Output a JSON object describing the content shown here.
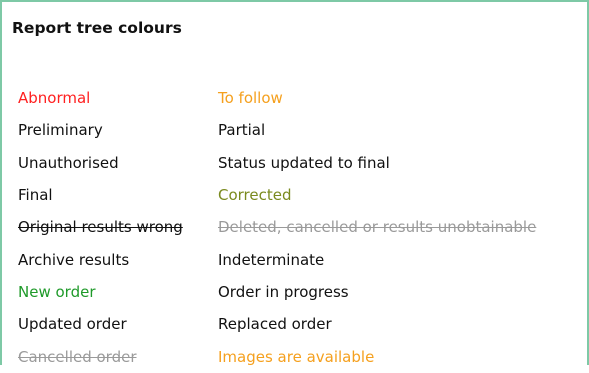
{
  "panel": {
    "title": "Report tree colours"
  },
  "legend": {
    "rows": [
      {
        "left": {
          "label": "Abnormal",
          "color": "#ff2020",
          "strikethrough": false
        },
        "right": {
          "label": "To follow",
          "color": "#f5a01e",
          "strikethrough": false
        }
      },
      {
        "left": {
          "label": "Preliminary",
          "color": "#111111",
          "strikethrough": false
        },
        "right": {
          "label": "Partial",
          "color": "#111111",
          "strikethrough": false
        }
      },
      {
        "left": {
          "label": "Unauthorised",
          "color": "#111111",
          "strikethrough": false
        },
        "right": {
          "label": "Status updated to final",
          "color": "#111111",
          "strikethrough": false
        }
      },
      {
        "left": {
          "label": "Final",
          "color": "#111111",
          "strikethrough": false
        },
        "right": {
          "label": "Corrected",
          "color": "#7a8a1e",
          "strikethrough": false
        }
      },
      {
        "left": {
          "label": "Original results wrong",
          "color": "#111111",
          "strikethrough": true
        },
        "right": {
          "label": "Deleted, cancelled or results unobtainable",
          "color": "#9a9a9a",
          "strikethrough": true
        }
      },
      {
        "left": {
          "label": "Archive results",
          "color": "#111111",
          "strikethrough": false
        },
        "right": {
          "label": "Indeterminate",
          "color": "#111111",
          "strikethrough": false
        }
      },
      {
        "left": {
          "label": "New order",
          "color": "#1f9a2a",
          "strikethrough": false
        },
        "right": {
          "label": "Order in progress",
          "color": "#111111",
          "strikethrough": false
        }
      },
      {
        "left": {
          "label": "Updated order",
          "color": "#111111",
          "strikethrough": false
        },
        "right": {
          "label": "Replaced order",
          "color": "#111111",
          "strikethrough": false
        }
      },
      {
        "left": {
          "label": "Cancelled order",
          "color": "#9a9a9a",
          "strikethrough": true
        },
        "right": {
          "label": "Images are available",
          "color": "#f5a01e",
          "strikethrough": false
        }
      }
    ]
  }
}
